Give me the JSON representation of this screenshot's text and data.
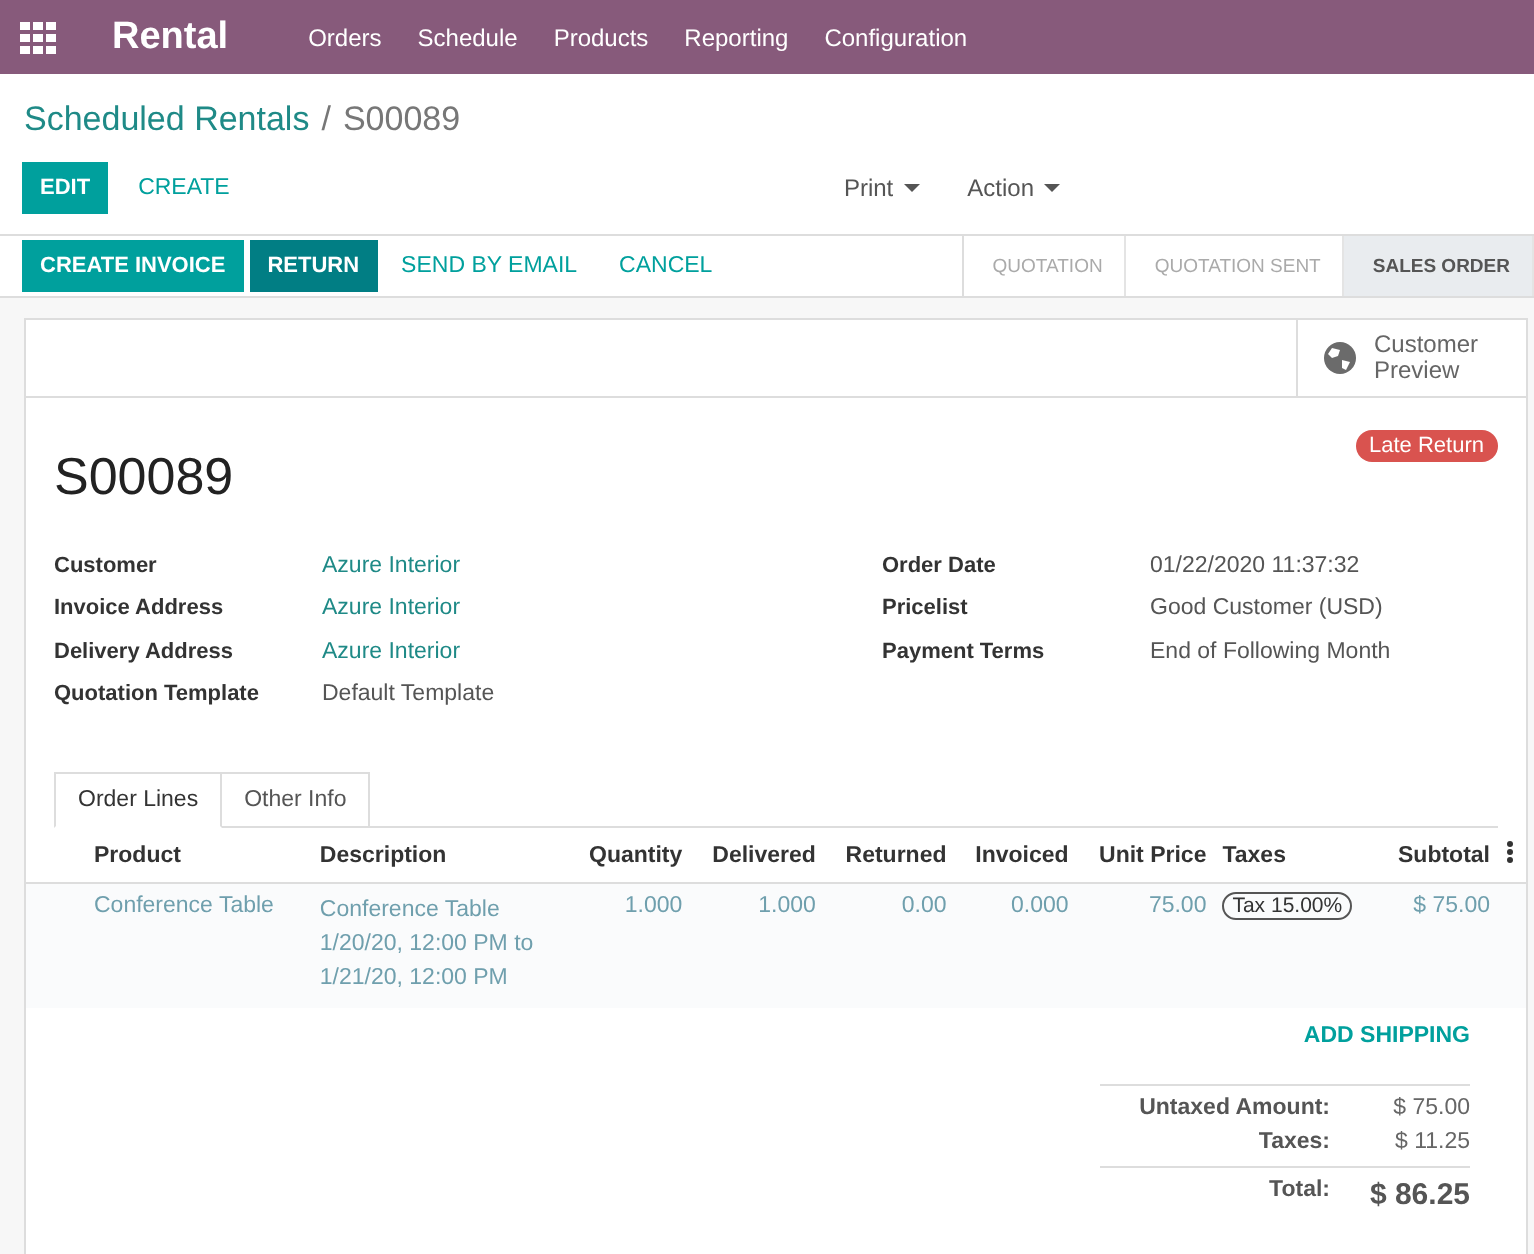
{
  "navbar": {
    "app_name": "Rental",
    "menu": [
      "Orders",
      "Schedule",
      "Products",
      "Reporting",
      "Configuration"
    ]
  },
  "breadcrumb": {
    "parent": "Scheduled Rentals",
    "separator": "/",
    "current": "S00089"
  },
  "control_buttons": [
    {
      "label": "EDIT",
      "kind": "primary"
    },
    {
      "label": "CREATE",
      "kind": "link"
    }
  ],
  "dropdowns": [
    "Print",
    "Action"
  ],
  "action_buttons": [
    {
      "label": "CREATE INVOICE",
      "kind": "primary"
    },
    {
      "label": "RETURN",
      "kind": "dark"
    },
    {
      "label": "SEND BY EMAIL",
      "kind": "link"
    },
    {
      "label": "CANCEL",
      "kind": "link"
    }
  ],
  "stages": [
    {
      "label": "QUOTATION",
      "selected": false
    },
    {
      "label": "QUOTATION SENT",
      "selected": false
    },
    {
      "label": "SALES ORDER",
      "selected": true
    }
  ],
  "customer_preview": "Customer Preview",
  "order": {
    "name": "S00089",
    "badge": "Late Return",
    "left_fields": [
      {
        "label": "Customer",
        "value": "Azure Interior",
        "kind": "link"
      },
      {
        "label": "Invoice Address",
        "value": "Azure Interior",
        "kind": "link"
      },
      {
        "label": "Delivery Address",
        "value": "Azure Interior",
        "kind": "link"
      },
      {
        "label": "Quotation Template",
        "value": "Default Template",
        "kind": "text"
      }
    ],
    "right_fields": [
      {
        "label": "Order Date",
        "value": "01/22/2020 11:37:32"
      },
      {
        "label": "Pricelist",
        "value": "Good Customer (USD)"
      },
      {
        "label": "Payment Terms",
        "value": "End of Following Month"
      }
    ]
  },
  "tabs": [
    {
      "label": "Order Lines",
      "selected": true
    },
    {
      "label": "Other Info",
      "selected": false
    }
  ],
  "table": {
    "columns": [
      "Product",
      "Description",
      "Quantity",
      "Delivered",
      "Returned",
      "Invoiced",
      "Unit Price",
      "Taxes",
      "Subtotal"
    ],
    "rows": [
      {
        "product": "Conference Table",
        "description": [
          "Conference Table",
          "1/20/20, 12:00 PM to",
          "1/21/20, 12:00 PM"
        ],
        "quantity": "1.000",
        "delivered": "1.000",
        "returned": "0.00",
        "invoiced": "0.000",
        "unit_price": "75.00",
        "tax": "Tax 15.00%",
        "subtotal": "$ 75.00"
      }
    ]
  },
  "add_shipping": "ADD SHIPPING",
  "totals": [
    {
      "label": "Untaxed Amount:",
      "value": "$ 75.00",
      "kind": "line"
    },
    {
      "label": "Taxes:",
      "value": "$ 11.25",
      "kind": "line"
    },
    {
      "label": "Total:",
      "value": "$ 86.25",
      "kind": "total"
    }
  ]
}
